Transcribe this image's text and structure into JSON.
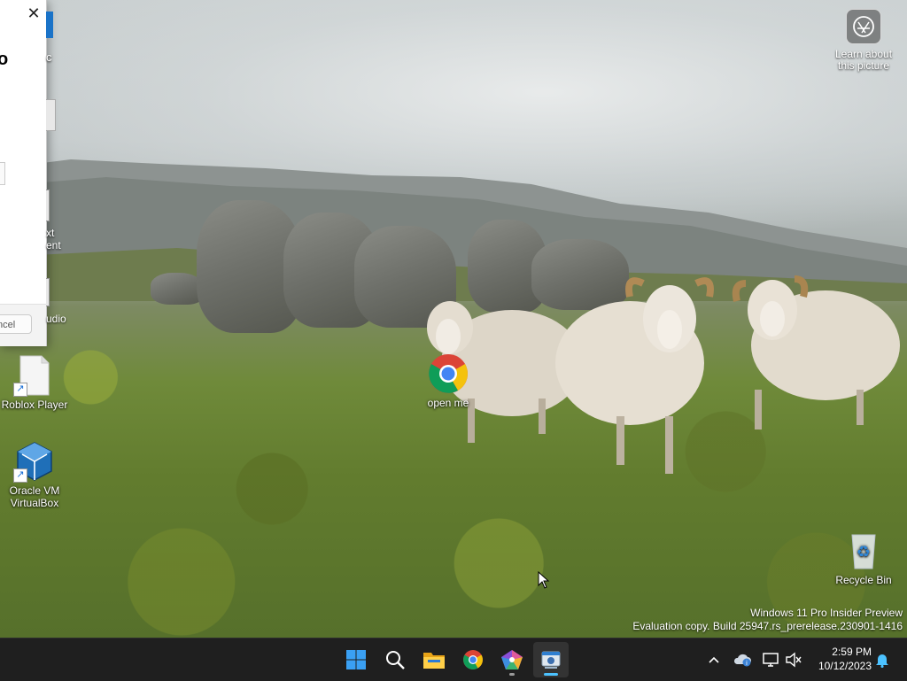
{
  "dialog": {
    "close_glyph": "✕",
    "heading_fragment": "o",
    "side_letter": "c",
    "cancel_label": "ncel"
  },
  "desktop": {
    "fragments": [
      {
        "id": "text-document-fragment",
        "lines": [
          "xt",
          "ent"
        ]
      },
      {
        "id": "audio-fragment",
        "lines": [
          "udio"
        ]
      }
    ],
    "icons": [
      {
        "id": "roblox-player",
        "label": "Roblox Player",
        "icon": "document-icon",
        "shortcut": true
      },
      {
        "id": "oracle-vm-virtualbox",
        "label": "Oracle VM VirtualBox",
        "icon": "virtualbox-icon",
        "shortcut": true
      },
      {
        "id": "open-me",
        "label": "open me",
        "icon": "chrome-icon",
        "shortcut": false
      },
      {
        "id": "recycle-bin",
        "label": "Recycle Bin",
        "icon": "recycle-bin-icon",
        "shortcut": false
      }
    ],
    "learn_about_picture": "Learn about this picture",
    "watermark": {
      "line1": "Windows 11 Pro Insider Preview",
      "line2": "Evaluation copy. Build 25947.rs_prerelease.230901-1416"
    }
  },
  "taskbar": {
    "apps": [
      {
        "id": "start",
        "icon": "windows-start-icon",
        "running": false
      },
      {
        "id": "search",
        "icon": "search-icon",
        "running": false
      },
      {
        "id": "file-explorer",
        "icon": "folder-icon",
        "running": false
      },
      {
        "id": "chrome",
        "icon": "chrome-icon",
        "running": false
      },
      {
        "id": "app-pentagon",
        "icon": "pentagon-app-icon",
        "running": true
      },
      {
        "id": "active-app",
        "icon": "installer-window-icon",
        "running": true,
        "active": true
      }
    ],
    "tray": [
      "chevron-up-icon",
      "onedrive-icon",
      "network-icon",
      "volume-muted-icon"
    ],
    "clock": {
      "time": "2:59 PM",
      "date": "10/12/2023"
    },
    "notification_icon": "bell-icon"
  },
  "colors": {
    "taskbar_bg": "#1f1f1f",
    "active_indicator": "#4cc2ff",
    "dialog_accent": "#1a73c8"
  }
}
